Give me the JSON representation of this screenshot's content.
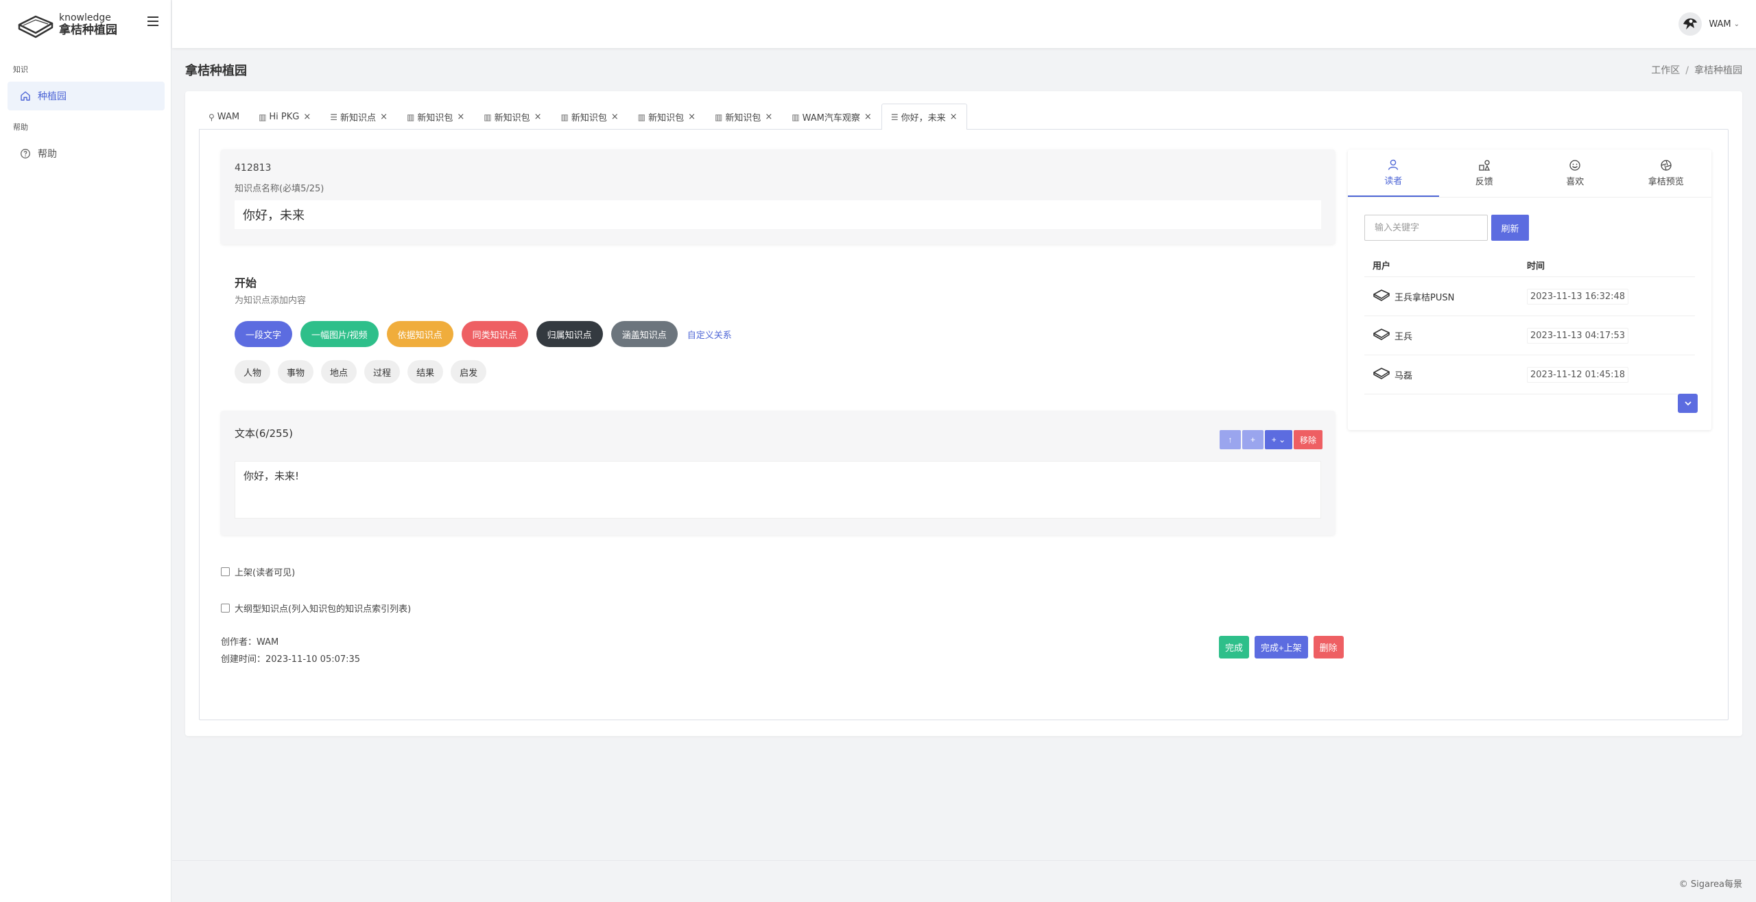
{
  "app": {
    "logo_en": "knowledge",
    "logo_cn": "拿桔种植园"
  },
  "sidebar": {
    "sections": [
      {
        "label": "知识",
        "items": [
          {
            "label": "种植园",
            "icon": "home-icon",
            "active": true
          }
        ]
      },
      {
        "label": "帮助",
        "items": [
          {
            "label": "帮助",
            "icon": "help-circle-icon",
            "active": false
          }
        ]
      }
    ]
  },
  "header": {
    "user_name": "WAM"
  },
  "page": {
    "title": "拿桔种植园",
    "breadcrumb": [
      "工作区",
      "拿桔种植园"
    ]
  },
  "tabs": [
    {
      "label": "WAM",
      "icon": "user-icon",
      "closable": false,
      "active": false
    },
    {
      "label": "Hi PKG",
      "icon": "book-icon",
      "closable": true,
      "active": false
    },
    {
      "label": "新知识点",
      "icon": "sliders-icon",
      "closable": true,
      "active": false
    },
    {
      "label": "新知识包",
      "icon": "book-icon",
      "closable": true,
      "active": false
    },
    {
      "label": "新知识包",
      "icon": "book-icon",
      "closable": true,
      "active": false
    },
    {
      "label": "新知识包",
      "icon": "book-icon",
      "closable": true,
      "active": false
    },
    {
      "label": "新知识包",
      "icon": "book-icon",
      "closable": true,
      "active": false
    },
    {
      "label": "新知识包",
      "icon": "book-icon",
      "closable": true,
      "active": false
    },
    {
      "label": "WAM汽车观察",
      "icon": "book-icon",
      "closable": true,
      "active": false
    },
    {
      "label": "你好，未来",
      "icon": "sliders-icon",
      "closable": true,
      "active": true
    }
  ],
  "editor": {
    "id": "412813",
    "name_label": "知识点名称(必填5/25)",
    "name_value": "你好，未来",
    "start_title": "开始",
    "start_sub": "为知识点添加内容",
    "pills": [
      {
        "label": "一段文字",
        "color": "#5c6ce0"
      },
      {
        "label": "一幅图片/视频",
        "color": "#2ebf8a"
      },
      {
        "label": "依据知识点",
        "color": "#f0ad3c"
      },
      {
        "label": "同类知识点",
        "color": "#ee5f63"
      },
      {
        "label": "归属知识点",
        "color": "#343a40"
      },
      {
        "label": "涵盖知识点",
        "color": "#6c757d"
      }
    ],
    "custom_relation": "自定义关系",
    "tags": [
      "人物",
      "事物",
      "地点",
      "过程",
      "结果",
      "启发"
    ],
    "text_block": {
      "title": "文本(6/255)",
      "up": "↑",
      "add": "+",
      "add_more": "+ ⌄",
      "remove": "移除",
      "content": "你好，未来!"
    },
    "checkbox_publish": "上架(读者可见)",
    "checkbox_outline": "大纲型知识点(列入知识包的知识点索引列表)",
    "creator": "创作者：WAM",
    "created_time": "创建时间：2023-11-10 05:07:35",
    "btn_done": "完成",
    "btn_done_publish": "完成+上架",
    "btn_delete": "删除"
  },
  "right_panel": {
    "tabs": [
      {
        "label": "读者",
        "icon": "user-icon",
        "active": true
      },
      {
        "label": "反馈",
        "icon": "shapes-icon",
        "active": false
      },
      {
        "label": "喜欢",
        "icon": "smile-icon",
        "active": false
      },
      {
        "label": "拿桔预览",
        "icon": "aperture-icon",
        "active": false
      }
    ],
    "search_placeholder": "输入关键字",
    "refresh_label": "刷新",
    "columns": [
      "用户",
      "时间"
    ],
    "rows": [
      {
        "user": "王兵拿桔PUSN",
        "time": "2023-11-13 16:32:48"
      },
      {
        "user": "王兵",
        "time": "2023-11-13 04:17:53"
      },
      {
        "user": "马磊",
        "time": "2023-11-12 01:45:18"
      }
    ]
  },
  "footer": {
    "text": "© Sigarea每景"
  },
  "colors": {
    "primary": "#5c6ce0",
    "success": "#2ebf8a",
    "danger": "#ee5f63",
    "warning": "#f0ad3c"
  }
}
